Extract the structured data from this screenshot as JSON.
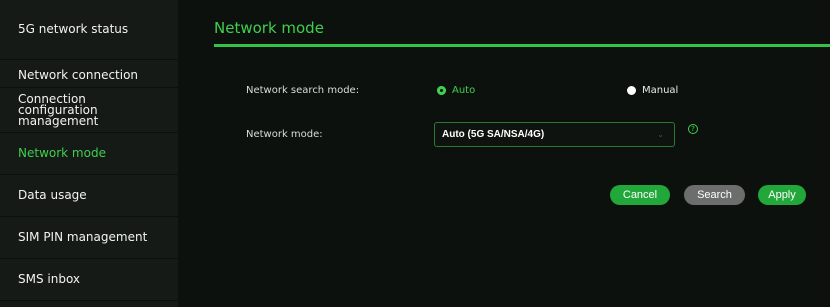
{
  "sidebar": {
    "items": [
      {
        "label": "5G network status"
      },
      {
        "label": "Network connection"
      },
      {
        "label": "Connection configuration management"
      },
      {
        "label": "Network mode"
      },
      {
        "label": "Data usage"
      },
      {
        "label": "SIM PIN management"
      },
      {
        "label": "SMS inbox"
      }
    ]
  },
  "main": {
    "title": "Network mode",
    "search_mode_label": "Network search mode:",
    "radio_auto": "Auto",
    "radio_manual": "Manual",
    "selected_search_mode": "Auto",
    "network_mode_label": "Network mode:",
    "network_mode_value": "Auto (5G SA/NSA/4G)",
    "help_icon": "?"
  },
  "actions": {
    "cancel": "Cancel",
    "search": "Search",
    "apply": "Apply"
  },
  "colors": {
    "accent": "#3fcf4e",
    "button_green": "#22a83a",
    "button_gray": "#6c6e6d"
  }
}
